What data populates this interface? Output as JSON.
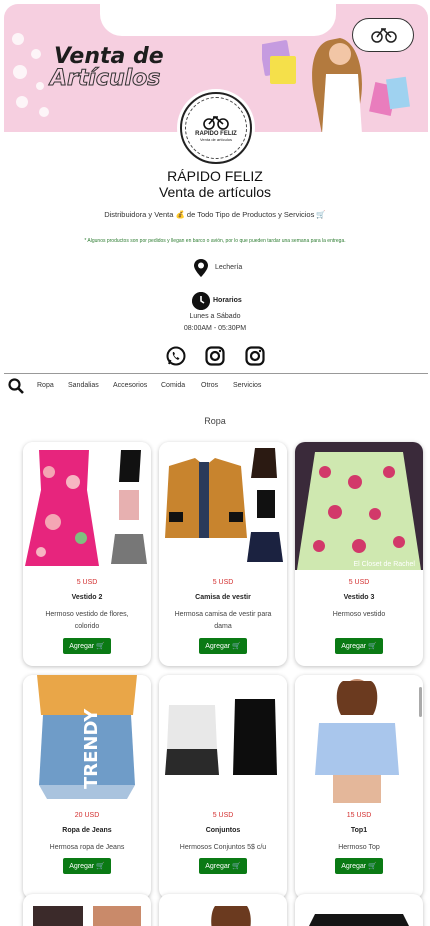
{
  "banner": {
    "title_line1": "Venta de",
    "title_line2": "Artículos",
    "logo_text": "RAPIDO FELIZ",
    "logo_sub": "Venta de artículos"
  },
  "store": {
    "name": "RÁPIDO FELIZ",
    "subtitle": "Venta de artículos",
    "description": "Distribuidora y Venta 💰 de Todo Tipo de Productos y Servicios 🛒",
    "notice": "* Algunos productos son por pedidos y llegan en barco o avión, por lo que pueden tardar una semana para la entrega."
  },
  "location": {
    "text": "Lechería"
  },
  "hours": {
    "title": "Horarios",
    "days": "Lunes a Sábado",
    "time": "08:00AM - 05:30PM"
  },
  "social": [
    "whatsapp-icon",
    "instagram-icon",
    "instagram-icon"
  ],
  "nav": {
    "items": [
      "Ropa",
      "Sandalias",
      "Accesorios",
      "Comida",
      "Otros",
      "Servicios"
    ]
  },
  "section": {
    "title": "Ropa"
  },
  "products": [
    {
      "price": "5 USD",
      "name": "Vestido 2",
      "description": "Hermoso vestido de flores, colorido",
      "button": "Agregar"
    },
    {
      "price": "5 USD",
      "name": "Camisa de vestir",
      "description": "Hermosa camisa de vestir para dama",
      "button": "Agregar"
    },
    {
      "price": "5 USD",
      "name": "Vestido 3",
      "description": "Hermoso vestido",
      "button": "Agregar"
    },
    {
      "price": "20 USD",
      "name": "Ropa de Jeans",
      "description": "Hermosa ropa de Jeans",
      "button": "Agregar"
    },
    {
      "price": "5 USD",
      "name": "Conjuntos",
      "description": "Hermosos Conjuntos 5$ c/u",
      "button": "Agregar"
    },
    {
      "price": "15 USD",
      "name": "Top1",
      "description": "Hermoso Top",
      "button": "Agregar"
    }
  ],
  "image_text": {
    "trendy": "TRENDY",
    "closet": "El Closet de Rachel"
  },
  "colors": {
    "accent_green": "#0a7a14",
    "price_red": "#d32f2f",
    "banner_pink": "#f6cfe0"
  }
}
